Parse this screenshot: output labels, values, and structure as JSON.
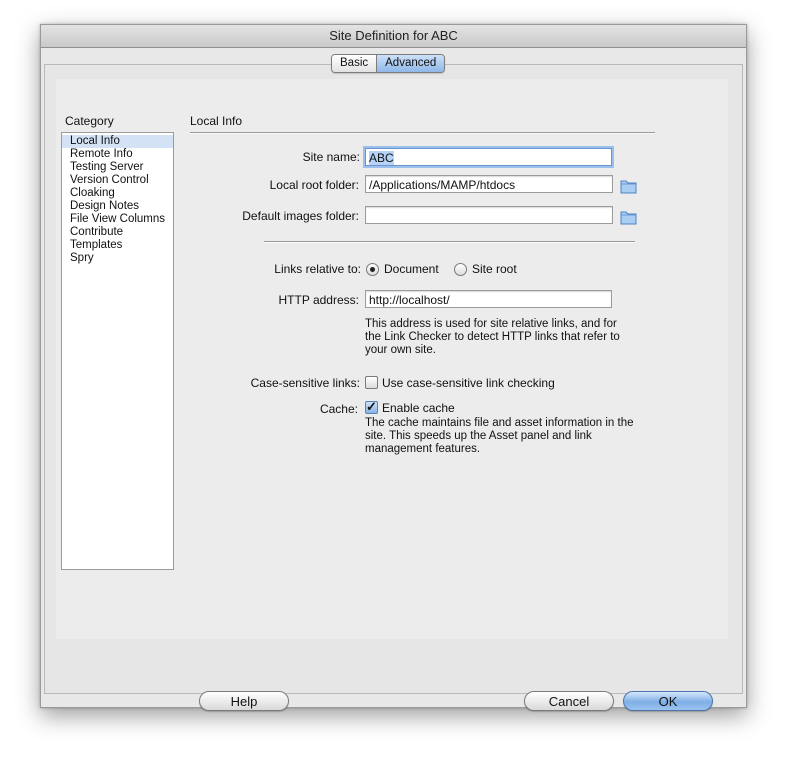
{
  "window": {
    "title": "Site Definition for ABC"
  },
  "tabs": [
    {
      "label": "Basic",
      "active": false
    },
    {
      "label": "Advanced",
      "active": true
    }
  ],
  "category": {
    "heading": "Category",
    "items": [
      "Local Info",
      "Remote Info",
      "Testing Server",
      "Version Control",
      "Cloaking",
      "Design Notes",
      "File View Columns",
      "Contribute",
      "Templates",
      "Spry"
    ],
    "selected": "Local Info"
  },
  "local_info": {
    "section_title": "Local Info",
    "site_name_label": "Site name:",
    "site_name_value": "ABC",
    "local_root_label": "Local root folder:",
    "local_root_value": "/Applications/MAMP/htdocs",
    "default_images_label": "Default images folder:",
    "default_images_value": "",
    "links_relative_label": "Links relative to:",
    "links_options": {
      "document": "Document",
      "site_root": "Site root"
    },
    "links_selected": "Document",
    "http_address_label": "HTTP address:",
    "http_address_value": "http://localhost/",
    "http_help": "This address is used for site relative links, and for the Link Checker to detect HTTP links that refer to your own site.",
    "case_sensitive_label": "Case-sensitive links:",
    "case_sensitive_option": "Use case-sensitive link checking",
    "case_sensitive_checked": false,
    "cache_label": "Cache:",
    "cache_option": "Enable cache",
    "cache_checked": true,
    "cache_help": "The cache maintains file and asset information in the site.  This speeds up the Asset panel and link management features."
  },
  "buttons": {
    "help": "Help",
    "cancel": "Cancel",
    "ok": "OK"
  },
  "icons": {
    "folder": "folder-icon",
    "checkmark": "checkmark-icon"
  },
  "colors": {
    "selection": "#d4e2f5",
    "accent": "#7eaee6"
  }
}
